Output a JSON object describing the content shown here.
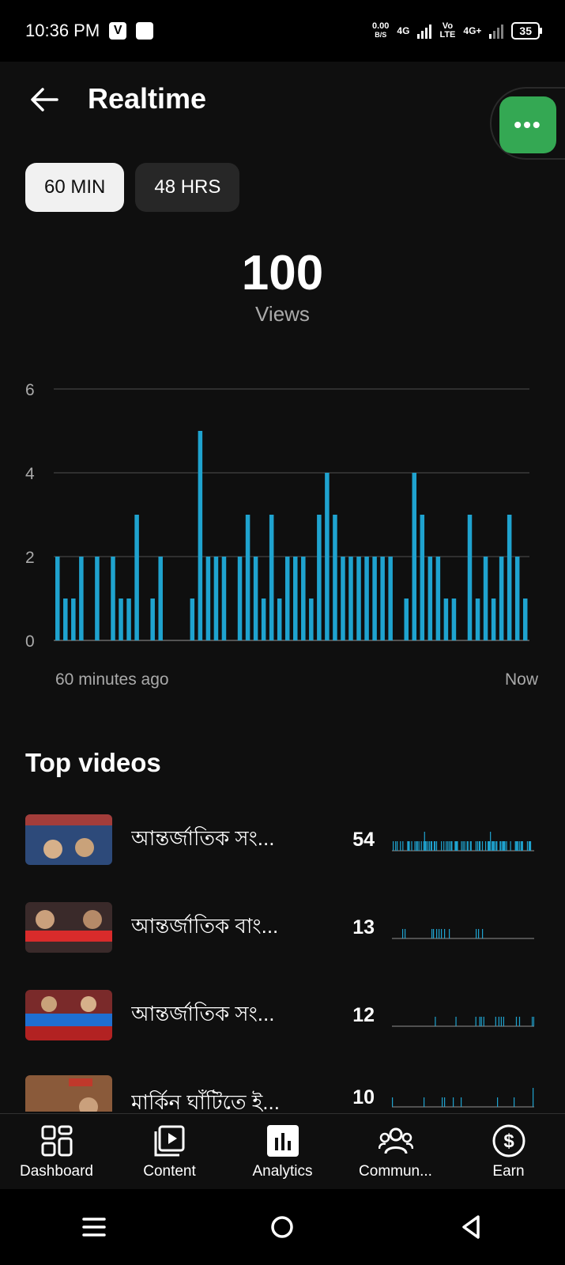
{
  "status_bar": {
    "time": "10:36 PM",
    "net_speed_top": "0.00",
    "net_speed_bottom": "B/S",
    "net_type1": "4G",
    "volte_top": "Vo",
    "volte_bottom": "LTE",
    "net_type2": "4G+",
    "battery": "35"
  },
  "header": {
    "title": "Realtime"
  },
  "chips": [
    {
      "label": "60 MIN",
      "active": true
    },
    {
      "label": "48 HRS",
      "active": false
    }
  ],
  "metric": {
    "value": "100",
    "label": "Views"
  },
  "chart_data": {
    "type": "bar",
    "yticks": [
      "6",
      "4",
      "2",
      "0"
    ],
    "ylim": [
      0,
      6
    ],
    "x_start_label": "60 minutes ago",
    "x_end_label": "Now",
    "values": [
      2,
      1,
      1,
      2,
      0,
      2,
      0,
      2,
      1,
      1,
      3,
      0,
      1,
      2,
      0,
      0,
      0,
      1,
      5,
      2,
      2,
      2,
      0,
      2,
      3,
      2,
      1,
      3,
      1,
      2,
      2,
      2,
      1,
      3,
      4,
      3,
      2,
      2,
      2,
      2,
      2,
      2,
      2,
      0,
      1,
      4,
      3,
      2,
      2,
      1,
      1,
      0,
      3,
      1,
      2,
      1,
      2,
      3,
      2,
      1
    ],
    "grid": true,
    "color": "#1fa3cf"
  },
  "top_videos": {
    "title": "Top videos",
    "items": [
      {
        "title": "আন্তর্জাতিক সং...",
        "views": "54",
        "thumb_colors": [
          "#2d4a7a",
          "#c0392b"
        ],
        "spark": [
          0,
          1,
          0,
          0,
          1,
          0,
          1,
          0,
          0,
          0,
          1,
          0,
          0,
          1,
          0,
          0,
          0,
          0,
          0,
          1,
          1,
          1,
          0,
          0,
          1,
          0,
          0,
          0,
          1,
          0,
          1,
          1,
          0,
          1,
          0,
          0,
          1,
          0,
          0,
          1,
          2,
          1,
          1,
          0,
          1,
          0,
          1,
          0,
          1,
          1,
          0,
          0,
          1,
          1,
          0,
          1,
          0,
          0,
          0,
          0,
          0,
          1,
          0,
          0,
          1,
          0,
          0,
          1,
          0,
          1,
          0,
          1,
          0,
          1,
          1,
          0,
          0,
          0,
          1,
          1,
          1,
          1,
          0,
          0,
          0,
          0,
          1,
          0,
          1,
          0,
          1,
          0,
          0,
          1,
          1,
          0,
          0,
          1,
          1,
          0,
          0,
          0,
          0,
          0,
          1,
          0,
          1,
          0,
          1,
          1,
          0,
          0,
          1,
          0,
          0,
          0,
          1,
          0,
          0,
          1,
          1,
          1,
          2,
          0,
          1,
          1,
          1,
          1,
          0,
          1,
          1,
          0,
          0,
          0,
          1,
          1,
          0,
          1,
          1,
          1,
          1,
          0,
          1,
          0,
          0,
          0,
          0,
          1,
          0,
          0,
          0,
          0,
          0,
          1,
          1,
          1,
          1,
          0,
          1,
          0,
          1,
          1,
          1,
          0,
          0,
          0,
          0,
          0,
          1,
          0,
          1,
          1,
          1,
          0,
          0,
          0,
          0
        ]
      },
      {
        "title": "আন্তর্জাতিক বাং...",
        "views": "13",
        "thumb_colors": [
          "#3a2a2a",
          "#d92b2b"
        ],
        "spark": [
          0,
          0,
          0,
          0,
          0,
          0,
          0,
          0,
          0,
          0,
          0,
          0,
          0,
          1,
          0,
          0,
          1,
          0,
          0,
          0,
          0,
          0,
          0,
          0,
          0,
          0,
          0,
          0,
          0,
          0,
          0,
          0,
          0,
          0,
          0,
          0,
          0,
          0,
          0,
          0,
          0,
          0,
          0,
          0,
          0,
          0,
          0,
          0,
          0,
          0,
          1,
          0,
          1,
          0,
          0,
          0,
          1,
          0,
          0,
          1,
          0,
          0,
          1,
          0,
          0,
          0,
          1,
          0,
          0,
          0,
          0,
          0,
          1,
          0,
          0,
          0,
          0,
          0,
          0,
          0,
          0,
          0,
          0,
          0,
          0,
          0,
          0,
          0,
          0,
          0,
          0,
          0,
          0,
          0,
          0,
          0,
          0,
          0,
          0,
          0,
          0,
          0,
          0,
          0,
          0,
          0,
          1,
          0,
          0,
          1,
          0,
          0,
          0,
          0,
          1,
          0,
          0,
          0,
          0,
          0,
          0,
          0,
          0,
          0,
          0,
          0,
          0,
          0,
          0,
          0,
          0,
          0,
          0,
          0,
          0,
          0,
          0,
          0,
          0,
          0,
          0,
          0,
          0,
          0,
          0,
          0,
          0,
          0,
          0,
          0,
          0,
          0,
          0,
          0,
          0,
          0,
          0,
          0,
          0,
          0,
          0,
          0,
          0,
          0,
          0,
          0,
          0,
          0,
          0,
          0,
          0,
          0,
          0,
          0,
          0,
          0,
          0,
          0,
          0,
          0
        ]
      },
      {
        "title": "আন্তর্জাতিক সং...",
        "views": "12",
        "thumb_colors": [
          "#7a2a2a",
          "#1f6fd1"
        ],
        "spark": [
          0,
          0,
          0,
          0,
          0,
          0,
          0,
          0,
          0,
          0,
          0,
          0,
          0,
          0,
          0,
          0,
          0,
          0,
          0,
          0,
          0,
          0,
          0,
          0,
          0,
          0,
          0,
          0,
          0,
          0,
          0,
          0,
          0,
          0,
          0,
          0,
          0,
          0,
          0,
          0,
          0,
          0,
          0,
          0,
          0,
          0,
          0,
          0,
          0,
          0,
          0,
          0,
          0,
          0,
          1,
          0,
          0,
          0,
          0,
          0,
          0,
          0,
          0,
          0,
          0,
          0,
          0,
          0,
          0,
          0,
          0,
          0,
          0,
          0,
          0,
          0,
          0,
          0,
          0,
          0,
          1,
          0,
          0,
          0,
          0,
          0,
          0,
          0,
          0,
          0,
          0,
          0,
          0,
          0,
          0,
          0,
          0,
          0,
          0,
          0,
          0,
          0,
          0,
          0,
          0,
          1,
          0,
          0,
          0,
          0,
          1,
          0,
          1,
          0,
          0,
          1,
          0,
          0,
          0,
          0,
          0,
          0,
          0,
          0,
          0,
          0,
          0,
          0,
          0,
          0,
          1,
          0,
          0,
          0,
          1,
          0,
          0,
          1,
          0,
          0,
          1,
          0,
          0,
          0,
          0,
          0,
          0,
          0,
          0,
          0,
          0,
          0,
          0,
          0,
          0,
          0,
          1,
          0,
          0,
          0,
          1,
          0,
          0,
          0,
          0,
          0,
          0,
          0,
          0,
          0,
          0,
          0,
          0,
          0,
          0,
          0,
          1,
          0,
          1
        ]
      },
      {
        "title": "মার্কিন ঘাঁটিতে ই...",
        "views": "10",
        "thumb_colors": [
          "#8a5a3a",
          "#c0392b"
        ],
        "spark": [
          1,
          0,
          0,
          0,
          0,
          0,
          0,
          0,
          0,
          0,
          0,
          0,
          0,
          0,
          0,
          0,
          0,
          0,
          0,
          0,
          0,
          0,
          0,
          0,
          0,
          0,
          0,
          0,
          0,
          0,
          0,
          0,
          0,
          0,
          0,
          0,
          0,
          0,
          0,
          0,
          1,
          0,
          0,
          0,
          0,
          0,
          0,
          0,
          0,
          0,
          0,
          0,
          0,
          0,
          0,
          0,
          0,
          0,
          0,
          0,
          0,
          0,
          0,
          1,
          0,
          0,
          1,
          0,
          0,
          0,
          0,
          0,
          0,
          0,
          0,
          0,
          0,
          1,
          0,
          0,
          0,
          0,
          0,
          0,
          0,
          0,
          0,
          1,
          0,
          0,
          0,
          0,
          0,
          0,
          0,
          0,
          0,
          0,
          0,
          0,
          0,
          0,
          0,
          0,
          0,
          0,
          0,
          0,
          0,
          0,
          0,
          0,
          0,
          0,
          0,
          0,
          0,
          0,
          0,
          0,
          0,
          0,
          0,
          0,
          0,
          0,
          0,
          0,
          0,
          0,
          0,
          0,
          0,
          1,
          0,
          0,
          0,
          0,
          0,
          0,
          0,
          0,
          0,
          0,
          0,
          0,
          0,
          0,
          0,
          0,
          0,
          0,
          0,
          0,
          1,
          0,
          0,
          0,
          0,
          0,
          0,
          0,
          0,
          0,
          0,
          0,
          0,
          0,
          0,
          0,
          0,
          0,
          0,
          0,
          0,
          0,
          0,
          0,
          2,
          0
        ]
      }
    ]
  },
  "bottom_nav": [
    {
      "label": "Dashboard",
      "icon": "dashboard-icon"
    },
    {
      "label": "Content",
      "icon": "content-icon"
    },
    {
      "label": "Analytics",
      "icon": "analytics-icon"
    },
    {
      "label": "Commun...",
      "icon": "community-icon"
    },
    {
      "label": "Earn",
      "icon": "earn-icon"
    }
  ]
}
